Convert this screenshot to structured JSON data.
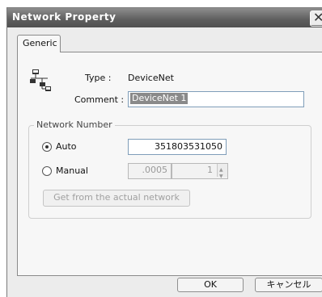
{
  "window": {
    "title": "Network Property",
    "close_glyph": "✕"
  },
  "tabs": [
    {
      "label": "Generic"
    }
  ],
  "generic": {
    "type_label": "Type :",
    "type_value": "DeviceNet",
    "comment_label": "Comment :",
    "comment_value": "DeviceNet 1"
  },
  "network_number": {
    "group_label": "Network Number",
    "auto_label": "Auto",
    "auto_selected": true,
    "auto_value": "351803531050",
    "manual_label": "Manual",
    "manual_value": ".0005",
    "manual_spin_value": "1",
    "get_button_label": "Get from the actual network"
  },
  "footer": {
    "ok_label": "OK",
    "cancel_label": "キャンセル"
  },
  "icons": {
    "network": "network-tree-icon"
  }
}
